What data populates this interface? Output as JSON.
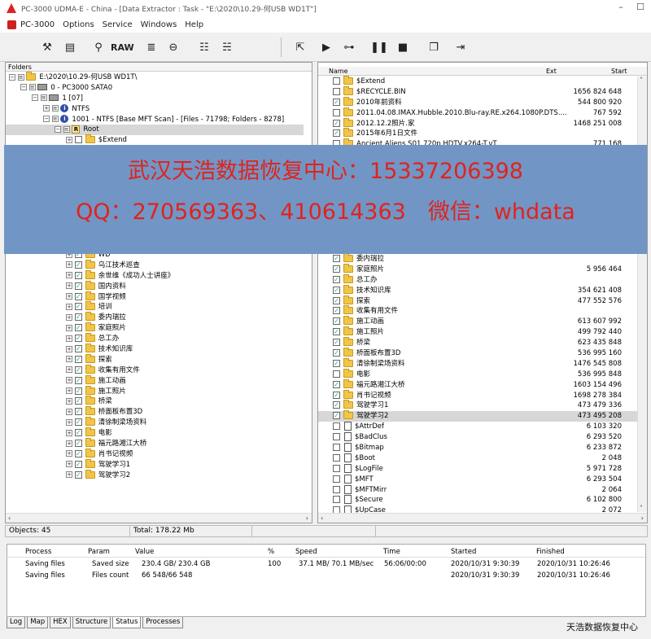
{
  "window": {
    "title": "PC-3000 UDMA-E - China - [Data Extractor : Task - \"E:\\2020\\10.29-何USB WD1T\"]"
  },
  "menu": [
    "PC-3000",
    "Options",
    "Service",
    "Windows",
    "Help"
  ],
  "toolbar": {
    "raw_label": "RAW"
  },
  "left_pane": {
    "header": "Folders",
    "tree": [
      "E:\\2020\\10.29-何USB WD1T\\",
      "0 - PC3000 SATA0",
      "1 [07]",
      "NTFS",
      "1001 - NTFS [Base MFT Scan] - [Files - 71798; Folders - 8278]",
      "Root",
      "$Extend"
    ],
    "folders": [
      "WD",
      "乌江技术巡查",
      "余世维《成功人士讲座》",
      "国内资料",
      "国学视频",
      "培训",
      "委内瑞拉",
      "家庭照片",
      "总工办",
      "技术知识库",
      "探索",
      "收集有用文件",
      "施工动画",
      "施工照片",
      "桥梁",
      "桥面板布置3D",
      "清徐制梁场资料",
      "电影",
      "福元路湘江大桥",
      "肖书记视频",
      "驾驶学习1",
      "驾驶学习2"
    ]
  },
  "right_pane": {
    "columns": {
      "name": "Name",
      "ext": "Ext",
      "start": "Start"
    },
    "top_rows": [
      {
        "name": "$Extend",
        "start": "",
        "type": "folder",
        "checked": false
      },
      {
        "name": "$RECYCLE.BIN",
        "start": "1656 824 648",
        "type": "folder",
        "checked": false
      },
      {
        "name": "2010年前资料",
        "start": "544 800 920",
        "type": "folder",
        "checked": true
      },
      {
        "name": "2011.04.08.IMAX.Hubble.2010.Blu-ray.RE.x264.1080P.DTS....",
        "start": "767 592",
        "type": "folder",
        "checked": false
      },
      {
        "name": "2012.12.2照片.家",
        "start": "1468 251 008",
        "type": "folder",
        "checked": true
      },
      {
        "name": "2015年6月1日文件",
        "start": "",
        "type": "folder",
        "checked": true
      },
      {
        "name": "Ancient.Aliens.S01.720p.HDTV.x264-T.vT",
        "start": "771 168",
        "type": "folder",
        "checked": false
      }
    ],
    "bottom_rows": [
      {
        "name": "委内瑞拉",
        "start": "",
        "type": "folder",
        "checked": true
      },
      {
        "name": "家庭照片",
        "start": "5 956 464",
        "type": "folder",
        "checked": true
      },
      {
        "name": "总工办",
        "start": "",
        "type": "folder",
        "checked": true
      },
      {
        "name": "技术知识库",
        "start": "354 621 408",
        "type": "folder",
        "checked": true
      },
      {
        "name": "探索",
        "start": "477 552 576",
        "type": "folder",
        "checked": true
      },
      {
        "name": "收集有用文件",
        "start": "",
        "type": "folder",
        "checked": true
      },
      {
        "name": "施工动画",
        "start": "613 607 992",
        "type": "folder",
        "checked": true
      },
      {
        "name": "施工照片",
        "start": "499 792 440",
        "type": "folder",
        "checked": true
      },
      {
        "name": "桥梁",
        "start": "623 435 848",
        "type": "folder",
        "checked": true
      },
      {
        "name": "桥面板布置3D",
        "start": "536 995 160",
        "type": "folder",
        "checked": true
      },
      {
        "name": "清徐制梁场资料",
        "start": "1476 545 808",
        "type": "folder",
        "checked": true
      },
      {
        "name": "电影",
        "start": "536 995 848",
        "type": "folder",
        "checked": false
      },
      {
        "name": "福元路湘江大桥",
        "start": "1603 154 496",
        "type": "folder",
        "checked": true
      },
      {
        "name": "肖书记视频",
        "start": "1698 278 384",
        "type": "folder",
        "checked": true
      },
      {
        "name": "驾驶学习1",
        "start": "473 479 336",
        "type": "folder",
        "checked": true
      },
      {
        "name": "驾驶学习2",
        "start": "473 495 208",
        "type": "folder",
        "checked": true
      },
      {
        "name": "$AttrDef",
        "start": "6 103 320",
        "type": "file",
        "checked": false
      },
      {
        "name": "$BadClus",
        "start": "6 293 520",
        "type": "file",
        "checked": false
      },
      {
        "name": "$Bitmap",
        "start": "6 233 872",
        "type": "file",
        "checked": false
      },
      {
        "name": "$Boot",
        "start": "2 048",
        "type": "file",
        "checked": false
      },
      {
        "name": "$LogFile",
        "start": "5 971 728",
        "type": "file",
        "checked": false
      },
      {
        "name": "$MFT",
        "start": "6 293 504",
        "type": "file",
        "checked": false
      },
      {
        "name": "$MFTMirr",
        "start": "2 064",
        "type": "file",
        "checked": false
      },
      {
        "name": "$Secure",
        "start": "6 102 800",
        "type": "file",
        "checked": false
      },
      {
        "name": "$UpCase",
        "start": "2 072",
        "type": "file",
        "checked": false
      }
    ]
  },
  "overlay": {
    "line1": "武汉天浩数据恢复中心：15337206398",
    "line2": "QQ：270569363、410614363　微信：whdata"
  },
  "statusbar": {
    "objects": "Objects: 45",
    "total": "Total: 178.22 Mb"
  },
  "processes": {
    "headers": {
      "process": "Process",
      "param": "Param",
      "value": "Value",
      "percent": "%",
      "speed": "Speed",
      "time": "Time",
      "started": "Started",
      "finished": "Finished"
    },
    "rows": [
      {
        "process": "Saving files",
        "param": "Saved size",
        "value": "230.4 GB/ 230.4 GB",
        "percent": "100",
        "speed": "37.1 MB/ 70.1 MB/sec",
        "time": "56:06/00:00",
        "started": "2020/10/31 9:30:39",
        "finished": "2020/10/31 10:26:46"
      },
      {
        "process": "Saving files",
        "param": "Files count",
        "value": "66 548/66 548",
        "percent": "",
        "speed": "",
        "time": "",
        "started": "2020/10/31 9:30:39",
        "finished": "2020/10/31 10:26:46"
      }
    ]
  },
  "bottom_tabs": [
    "Log",
    "Map",
    "HEX",
    "Structure",
    "Status",
    "Processes"
  ],
  "watermark": "天浩数据恢复中心"
}
